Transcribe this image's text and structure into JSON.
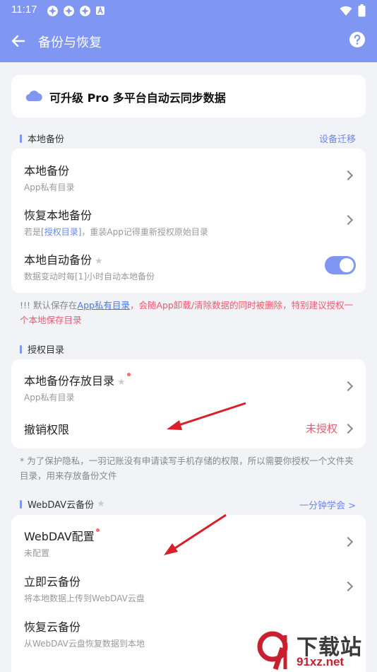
{
  "status_bar": {
    "time": "11:17",
    "notification_icons": [
      "pinwheel-icon",
      "pinwheel-icon",
      "pinwheel-icon",
      "a-icon"
    ],
    "right_icons": [
      "wifi-icon",
      "battery-icon"
    ]
  },
  "app_bar": {
    "title": "备份与恢复",
    "back_icon": "back-arrow-icon",
    "help_icon": "help-icon"
  },
  "promo": {
    "text": "可升级 Pro 多平台自动云同步数据",
    "icon": "cloud-icon"
  },
  "local_backup": {
    "header": "本地备份",
    "link": "设备迁移",
    "items": [
      {
        "title": "本地备份",
        "subtitle": "App私有目录"
      },
      {
        "title": "恢复本地备份",
        "subtitle_prefix": "若是",
        "subtitle_link": "[授权目录]",
        "subtitle_suffix": "，重装App记得重新授权原始目录"
      },
      {
        "title": "本地自动备份",
        "subtitle": "数据变动时每[1]小时自动本地备份",
        "toggle_on": true
      }
    ],
    "note": {
      "prefix": "!!! 默认保存在",
      "link": "App私有目录",
      "warning": "，会随App卸载/清除数据的同时被删除，特别建议授权一个本地保存目录"
    }
  },
  "auth_dir": {
    "header": "授权目录",
    "items": [
      {
        "title": "本地备份存放目录",
        "subtitle": "App私有目录"
      },
      {
        "title": "撤销权限",
        "status": "未授权"
      }
    ],
    "note": "* 为了保护隐私，一羽记账没有申请读写手机存储的权限，所以需要你授权一个文件夹目录，用来存放备份文件"
  },
  "webdav": {
    "header": "WebDAV云备份",
    "link": "一分钟学会 >",
    "items": [
      {
        "title": "WebDAV配置",
        "subtitle": "未配置"
      },
      {
        "title": "立即云备份",
        "subtitle": "将本地数据上传到WebDAV云盘"
      },
      {
        "title": "恢复云备份",
        "subtitle": "从WebDAV云盘恢复数据到本地"
      }
    ]
  },
  "watermark": {
    "line1": "下载站",
    "line2": "91xz.net"
  },
  "colors": {
    "accent": "#7f97f3",
    "warning": "#ef5a6f",
    "link": "#6a86ee"
  }
}
